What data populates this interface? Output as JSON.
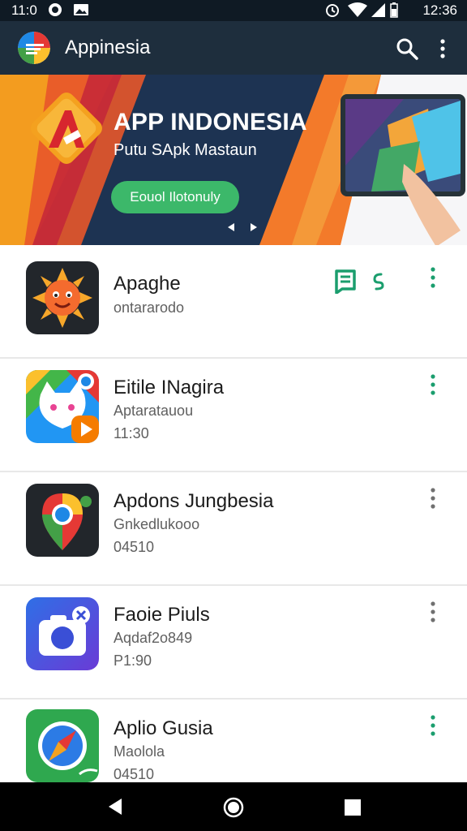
{
  "status_bar": {
    "time_left": "11:0",
    "time_right": "12:36",
    "icons": [
      "circle-icon",
      "image-icon",
      "alarm-icon",
      "wifi-icon",
      "signal-icon",
      "battery-icon"
    ]
  },
  "app_bar": {
    "title": "Appinesia",
    "icons": [
      "app-logo",
      "search-icon",
      "more-vert-icon"
    ]
  },
  "banner": {
    "title": "APP INDONESIA",
    "subtitle": "Putu SApk Mastaun",
    "button_label": "Eouol Ilotonuly",
    "colors": {
      "orange": "#f37a2a",
      "navy": "#1d3352",
      "green_button": "#3cb86a"
    }
  },
  "apps": [
    {
      "name": "Apaghe",
      "line1": "ontararodo",
      "line2": "",
      "icon": "sun-face-icon",
      "actions": [
        "bookmark-icon",
        "link-icon"
      ]
    },
    {
      "name": "Eitile INagira",
      "line1": "Aptaratauou",
      "line2": "11:30",
      "icon": "cat-app-icon",
      "actions": []
    },
    {
      "name": "Apdons Jungbesia",
      "line1": "Gnkedlukooo",
      "line2": "04510",
      "icon": "maps-chrome-icon",
      "actions": []
    },
    {
      "name": "Faoie Piuls",
      "line1": "Aqdaf2o849",
      "line2": "P1:90",
      "icon": "camera-icon",
      "actions": []
    },
    {
      "name": "Aplio Gusia",
      "line1": "Maolola",
      "line2": "04510",
      "icon": "compass-icon",
      "actions": []
    }
  ],
  "nav_bar": {
    "icons": [
      "back-icon",
      "home-icon",
      "recents-icon"
    ]
  }
}
